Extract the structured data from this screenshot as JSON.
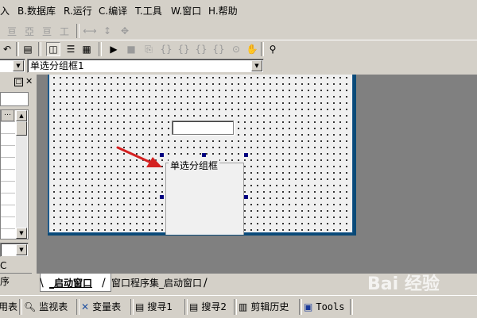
{
  "menu": [
    {
      "label": "入"
    },
    {
      "label": "B.数据库"
    },
    {
      "label": "R.运行"
    },
    {
      "label": "C.编译"
    },
    {
      "label": "T.工具"
    },
    {
      "label": "W.窗口"
    },
    {
      "label": "H.帮助"
    }
  ],
  "object_combo": {
    "value": "单选分组框1"
  },
  "form": {
    "groupbox_label": "单选分组框"
  },
  "left_panel": {
    "label_c": "C",
    "label_seq": "序"
  },
  "tabs": [
    {
      "label": "_启动窗口"
    },
    {
      "label": "窗口程序集_启动窗口"
    }
  ],
  "bottom_bar": [
    {
      "label": "用表",
      "icon": "table-icon"
    },
    {
      "label": "监视表",
      "icon": "magnifier-icon"
    },
    {
      "label": "变量表",
      "icon": "variables-icon"
    },
    {
      "label": "搜寻1",
      "icon": "search-list-icon"
    },
    {
      "label": "搜寻2",
      "icon": "search-list-icon"
    },
    {
      "label": "剪辑历史",
      "icon": "clipboard-icon"
    },
    {
      "label": "Tools",
      "icon": "window-icon"
    }
  ],
  "watermark": {
    "text": "Bai 经验"
  },
  "colors": {
    "arrow": "#d42020",
    "handle": "#000080",
    "form_border": "#1e5a8c",
    "workspace": "#808080"
  }
}
